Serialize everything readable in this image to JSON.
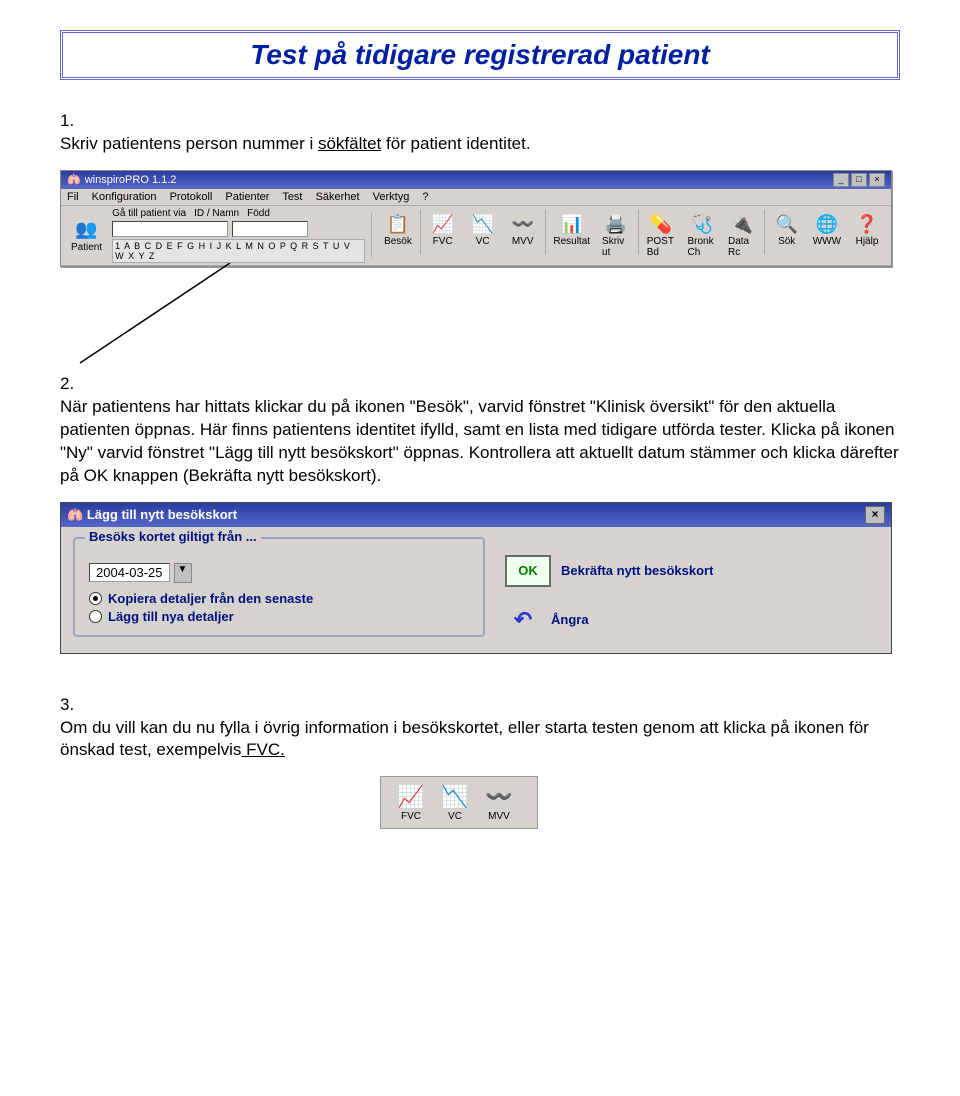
{
  "title": "Test på tidigare registrerad patient",
  "step1": {
    "num": "1.",
    "text_a": "Skriv patientens person nummer i ",
    "link": "sökfältet",
    "text_b": " för patient identitet."
  },
  "toolbar": {
    "app_title": "winspiroPRO 1.1.2",
    "menu": [
      "Fil",
      "Konfiguration",
      "Protokoll",
      "Patienter",
      "Test",
      "Säkerhet",
      "Verktyg",
      "?"
    ],
    "patient_btn": "Patient",
    "labels": {
      "ga": "Gå till patient via",
      "id": "ID / Namn",
      "fodd": "Född"
    },
    "alpha": "1 A B C D E F G H I J K L M N O P Q R S T U V W X Y Z",
    "buttons": [
      "Besök",
      "FVC",
      "VC",
      "MVV",
      "Resultat",
      "Skriv ut",
      "POST Bd",
      "Bronk Ch",
      "Data Rc",
      "Sök",
      "WWW",
      "Hjälp"
    ],
    "icons": [
      "📋",
      "📈",
      "📉",
      "〰️",
      "📊",
      "🖨️",
      "💊",
      "🩺",
      "🔌",
      "🔍",
      "🌐",
      "❓"
    ]
  },
  "step2": {
    "num": "2.",
    "text": "När patientens har hittats klickar du på ikonen \"Besök\", varvid fönstret \"Klinisk översikt\" för den aktuella patienten öppnas. Här finns patientens identitet ifylld, samt en lista med tidigare utförda tester. Klicka på ikonen \"Ny\" varvid fönstret \"Lägg till nytt besökskort\" öppnas. Kontrollera att aktuellt datum stämmer och klicka därefter på OK knappen (Bekräfta nytt besökskort)."
  },
  "dialog": {
    "title": "Lägg till nytt besökskort",
    "group_legend": "Besöks kortet giltigt från ...",
    "date": "2004-03-25",
    "opt1": "Kopiera detaljer från den senaste",
    "opt2": "Lägg till nya detaljer",
    "ok_label": "OK",
    "ok_text": "Bekräfta nytt besökskort",
    "undo_text": "Ångra"
  },
  "step3": {
    "num": "3.",
    "text_a": "Om du vill kan du nu fylla i övrig information i besökskortet, eller starta testen genom att klicka på ikonen för önskad test, exempelvis",
    "link": " FVC."
  },
  "mini": {
    "items": [
      {
        "label": "FVC",
        "icon": "📈"
      },
      {
        "label": "VC",
        "icon": "📉"
      },
      {
        "label": "MVV",
        "icon": "〰️"
      }
    ]
  }
}
